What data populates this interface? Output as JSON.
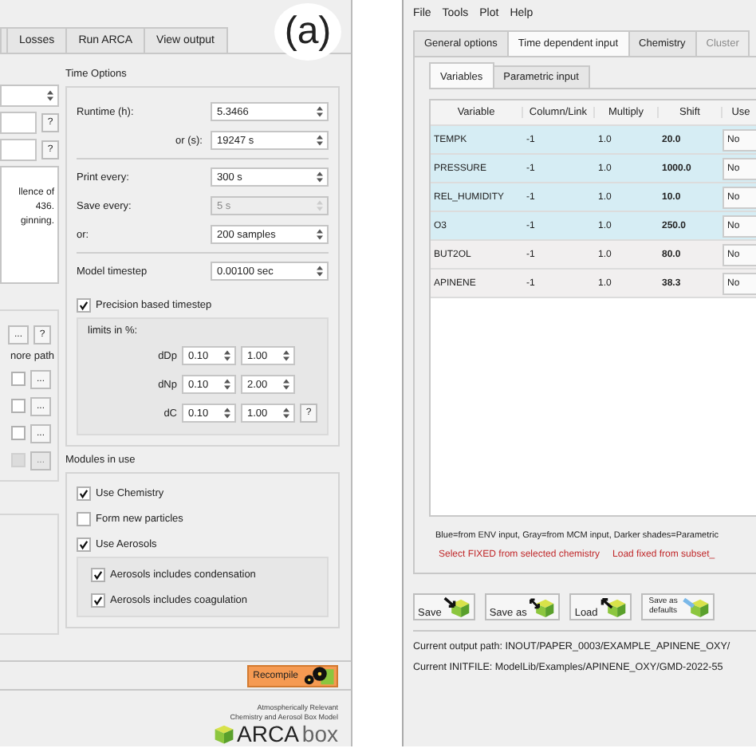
{
  "figure_label": "(a)",
  "left_window": {
    "tabs": [
      {
        "label": "Losses",
        "selected": false
      },
      {
        "label": "Run ARCA",
        "selected": false
      },
      {
        "label": "View output",
        "selected": false
      }
    ],
    "side": {
      "help_buttons": [
        "?",
        "?"
      ],
      "description_lines": [
        "llence of",
        "436.",
        "ginning."
      ],
      "browse_row": {
        "browse": "...",
        "help": "?"
      },
      "path_label": "nore path",
      "file_rows": [
        {
          "checked": false,
          "browse": "...",
          "disabled": false
        },
        {
          "checked": false,
          "browse": "...",
          "disabled": false
        },
        {
          "checked": false,
          "browse": "...",
          "disabled": false
        },
        {
          "checked": false,
          "browse": "...",
          "disabled": true
        }
      ]
    },
    "time_options": {
      "title": "Time Options",
      "sections": [
        [
          {
            "label": "Runtime (h):",
            "value": "5.3466",
            "disabled": false,
            "kind": "left"
          },
          {
            "label": "or (s):",
            "value": "19247 s",
            "disabled": false,
            "kind": "right"
          }
        ],
        [
          {
            "label": "Print every:",
            "value": "300 s",
            "disabled": false,
            "kind": "left"
          },
          {
            "label": "Save every:",
            "value": "5 s",
            "disabled": true,
            "kind": "left"
          },
          {
            "label": "or:",
            "value": "200 samples",
            "disabled": false,
            "kind": "left"
          }
        ],
        [
          {
            "label": "Model timestep",
            "value": "0.00100 sec",
            "disabled": false,
            "kind": "left"
          }
        ]
      ],
      "precision": {
        "label": "Precision based timestep",
        "checked": true
      },
      "limits": {
        "title": "limits in %:",
        "rows": [
          {
            "label": "dDp",
            "min": "0.10",
            "max": "1.00"
          },
          {
            "label": "dNp",
            "min": "0.10",
            "max": "2.00"
          },
          {
            "label": "dC",
            "min": "0.10",
            "max": "1.00",
            "help": "?"
          }
        ]
      }
    },
    "modules": {
      "title": "Modules in use",
      "items": [
        {
          "label": "Use Chemistry",
          "checked": true
        },
        {
          "label": "Form new particles",
          "checked": false
        },
        {
          "label": "Use Aerosols",
          "checked": true
        }
      ],
      "aerosol_options": [
        {
          "label": "Aerosols includes condensation",
          "checked": true
        },
        {
          "label": "Aerosols includes coagulation",
          "checked": true
        }
      ]
    },
    "recompile": "Recompile",
    "logo": {
      "tagline_lines": [
        "Atmospherically Relevant",
        "Chemistry and Aerosol Box Model"
      ],
      "name": "ARCA",
      "suffix": "box"
    }
  },
  "right_window": {
    "menu": [
      "File",
      "Tools",
      "Plot",
      "Help"
    ],
    "tabs": [
      {
        "label": "General options",
        "selected": false,
        "disabled": false
      },
      {
        "label": "Time dependent input",
        "selected": true,
        "disabled": false
      },
      {
        "label": "Chemistry",
        "selected": false,
        "disabled": false
      },
      {
        "label": "Cluster",
        "selected": false,
        "disabled": true
      }
    ],
    "subtabs": [
      {
        "label": "Variables",
        "selected": true
      },
      {
        "label": "Parametric input",
        "selected": false
      }
    ],
    "table": {
      "columns": [
        "Variable",
        "Column/Link",
        "Multiply",
        "Shift",
        "Use"
      ],
      "rows": [
        {
          "cells": [
            "TEMPK",
            "-1",
            "1.0",
            "20.0",
            "No"
          ],
          "color": "#d6edf4"
        },
        {
          "cells": [
            "PRESSURE",
            "-1",
            "1.0",
            "1000.0",
            "No"
          ],
          "color": "#d6edf4"
        },
        {
          "cells": [
            "REL_HUMIDITY",
            "-1",
            "1.0",
            "10.0",
            "No"
          ],
          "color": "#d6edf4"
        },
        {
          "cells": [
            "O3",
            "-1",
            "1.0",
            "250.0",
            "No"
          ],
          "color": "#d6edf4"
        },
        {
          "cells": [
            "BUT2OL",
            "-1",
            "1.0",
            "80.0",
            "No"
          ],
          "color": "#f1efef"
        },
        {
          "cells": [
            "APINENE",
            "-1",
            "1.0",
            "38.3",
            "No"
          ],
          "color": "#f1efef"
        }
      ]
    },
    "legend": "Blue=from ENV input, Gray=from MCM input, Darker shades=Parametric",
    "links": [
      "Select FIXED from selected chemistry",
      "Load fixed from subset_"
    ],
    "buttons": [
      {
        "label": "Save",
        "kind": "save"
      },
      {
        "label": "Save as",
        "kind": "saveas"
      },
      {
        "label": "Load",
        "kind": "load"
      },
      {
        "label": "Save as defaults",
        "kind": "defaults"
      }
    ],
    "output_path": "Current output path: INOUT/PAPER_0003/EXAMPLE_APINENE_OXY/",
    "initfile": "Current INITFILE: ModelLib/Examples/APINENE_OXY/GMD-2022-55"
  }
}
